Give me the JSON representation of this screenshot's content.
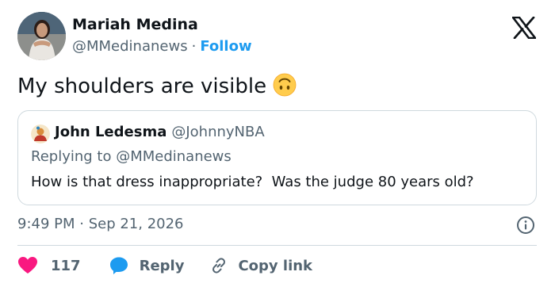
{
  "author": {
    "name": "Mariah Medina",
    "handle": "@MMedinanews",
    "separator": "·",
    "follow_label": "Follow"
  },
  "tweet": {
    "text": "My shoulders are visible",
    "emoji": "upside-down-face-icon"
  },
  "quoted": {
    "name": "John Ledesma",
    "handle": "@JohnnyNBA",
    "replying_to": "Replying to @MMedinanews",
    "text": "How is that dress inappropriate?  Was the judge 80 years old?"
  },
  "timestamp": "9:49 PM · Sep 21, 2026",
  "actions": {
    "like_count": "117",
    "reply_label": "Reply",
    "copy_label": "Copy link"
  },
  "colors": {
    "accent": "#1d9bf0",
    "like": "#f91880",
    "secondary_text": "#536471",
    "border": "#cfd9de"
  }
}
